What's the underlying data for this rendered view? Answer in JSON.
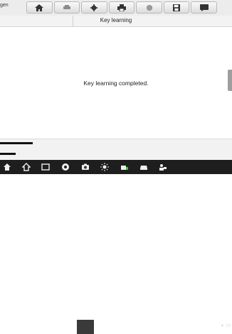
{
  "header": {
    "vehicle_label": "gen"
  },
  "toolbar": {
    "buttons": [
      {
        "icon": "home-icon"
      },
      {
        "icon": "vehicle-swap-icon"
      },
      {
        "icon": "gear-icon"
      },
      {
        "icon": "print-icon"
      },
      {
        "icon": "help-icon"
      },
      {
        "icon": "save-icon"
      },
      {
        "icon": "data-logging-icon"
      }
    ]
  },
  "page": {
    "title": "Key learning",
    "message": "Key learning completed."
  },
  "nav": {
    "icons": [
      "back-icon",
      "home-icon",
      "recent-apps-icon",
      "chrome-icon",
      "camera-icon",
      "brightness-icon",
      "battery-scan-icon",
      "car-icon",
      "user-car-icon"
    ],
    "status_text": "29"
  },
  "colors": {
    "topbar": "#ececec",
    "navbar": "#1e1e1e",
    "handle": "#9e9e9e"
  }
}
